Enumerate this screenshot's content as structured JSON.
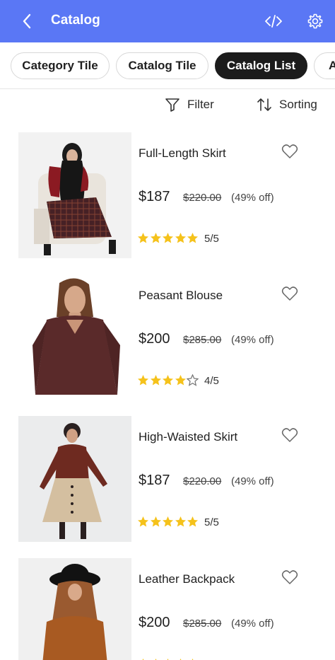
{
  "header": {
    "title": "Catalog",
    "back_icon": "chevron-left-icon",
    "code_icon": "code-icon",
    "settings_icon": "gear-icon",
    "bar_color": "#5a77f5"
  },
  "tabs": [
    {
      "label": "Category Tile",
      "active": false
    },
    {
      "label": "Catalog Tile",
      "active": false
    },
    {
      "label": "Catalog List",
      "active": true
    },
    {
      "label": "A",
      "active": false
    }
  ],
  "toolbar": {
    "filter_label": "Filter",
    "sorting_label": "Sorting"
  },
  "products": [
    {
      "name": "Full-Length Skirt",
      "price": "$187",
      "old_price": "$220.00",
      "discount": "(49% off)",
      "rating_text": "5/5",
      "stars": 5
    },
    {
      "name": "Peasant Blouse",
      "price": "$200",
      "old_price": "$285.00",
      "discount": "(49% off)",
      "rating_text": "4/5",
      "stars": 4
    },
    {
      "name": "High-Waisted Skirt",
      "price": "$187",
      "old_price": "$220.00",
      "discount": "(49% off)",
      "rating_text": "5/5",
      "stars": 5
    },
    {
      "name": "Leather Backpack",
      "price": "$200",
      "old_price": "$285.00",
      "discount": "(49% off)",
      "rating_text": "",
      "stars": 5
    }
  ],
  "colors": {
    "star": "#f5c21b",
    "active_tab": "#1c1c1c"
  }
}
